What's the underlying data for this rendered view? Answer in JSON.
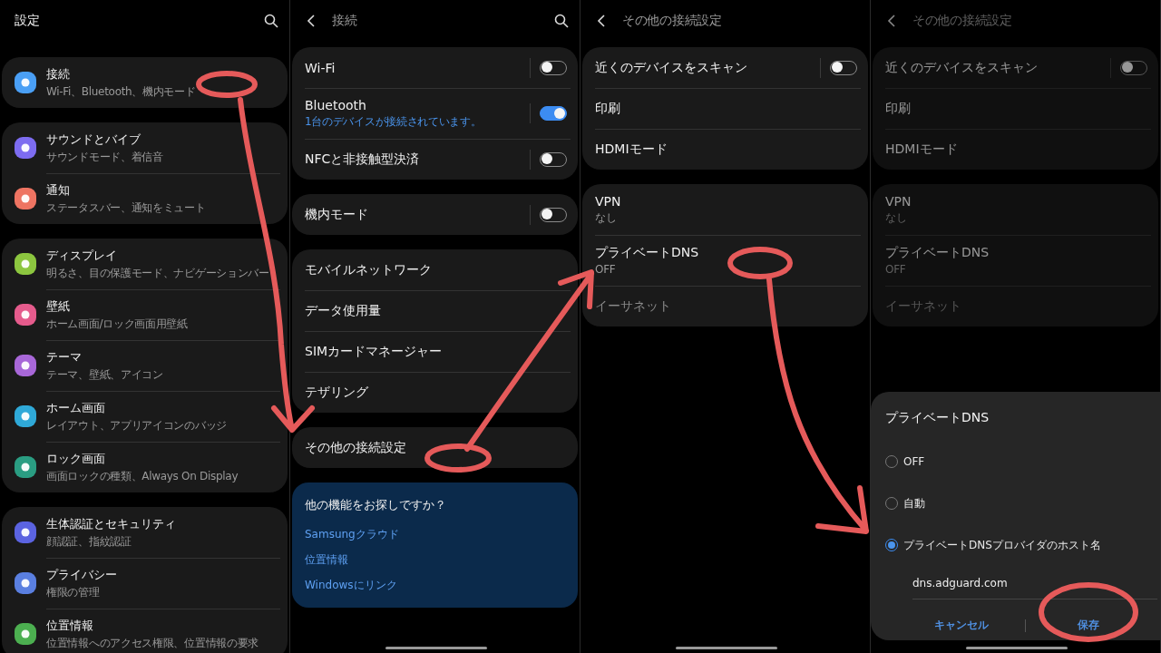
{
  "screens": [
    {
      "kind": "main",
      "title": "設定",
      "search_button": true,
      "dimmed": false,
      "groups": [
        {
          "items": [
            {
              "kind": "link",
              "title": "接続",
              "subtitle": "Wi-Fi、Bluetooth、機内モード",
              "color": "#4a9ff5"
            }
          ]
        },
        {
          "items": [
            {
              "kind": "link",
              "title": "サウンドとバイブ",
              "subtitle": "サウンドモード、着信音",
              "color": "#7d6cf0"
            },
            {
              "kind": "link",
              "title": "通知",
              "subtitle": "ステータスバー、通知をミュート",
              "color": "#ee7462"
            }
          ]
        },
        {
          "items": [
            {
              "kind": "link",
              "title": "ディスプレイ",
              "subtitle": "明るさ、目の保護モード、ナビゲーションバー",
              "color": "#8cc63f"
            },
            {
              "kind": "link",
              "title": "壁紙",
              "subtitle": "ホーム画面/ロック画面用壁紙",
              "color": "#e55b8c"
            },
            {
              "kind": "link",
              "title": "テーマ",
              "subtitle": "テーマ、壁紙、アイコン",
              "color": "#a867d8"
            },
            {
              "kind": "link",
              "title": "ホーム画面",
              "subtitle": "レイアウト、アプリアイコンのバッジ",
              "color": "#2fa9d8"
            },
            {
              "kind": "link",
              "title": "ロック画面",
              "subtitle": "画面ロックの種類、Always On Display",
              "color": "#2a9d82"
            }
          ]
        },
        {
          "items": [
            {
              "kind": "link",
              "title": "生体認証とセキュリティ",
              "subtitle": "顔認証、指紋認証",
              "color": "#5b63e0"
            },
            {
              "kind": "link",
              "title": "プライバシー",
              "subtitle": "権限の管理",
              "color": "#5a7fe0"
            },
            {
              "kind": "link",
              "title": "位置情報",
              "subtitle": "位置情報へのアクセス権限、位置情報の要求",
              "color": "#4caf50"
            }
          ]
        }
      ]
    },
    {
      "kind": "sub",
      "title": "接続",
      "search_button": true,
      "dimmed": false,
      "groups": [
        {
          "items": [
            {
              "kind": "switch",
              "title": "Wi-Fi",
              "on": false
            },
            {
              "kind": "switch",
              "title": "Bluetooth",
              "subtitle": "1台のデバイスが接続されています。",
              "subtitle_accent": true,
              "on": true
            },
            {
              "kind": "switch",
              "title": "NFCと非接触型決済",
              "on": false
            }
          ]
        },
        {
          "items": [
            {
              "kind": "switch",
              "title": "機内モード",
              "on": false
            }
          ]
        },
        {
          "items": [
            {
              "kind": "link",
              "title": "モバイルネットワーク"
            },
            {
              "kind": "link",
              "title": "データ使用量"
            },
            {
              "kind": "link",
              "title": "SIMカードマネージャー"
            },
            {
              "kind": "link",
              "title": "テザリング"
            }
          ]
        },
        {
          "items": [
            {
              "kind": "link",
              "title": "その他の接続設定"
            }
          ]
        }
      ],
      "promo": {
        "title": "他の機能をお探しですか？",
        "links": [
          "Samsungクラウド",
          "位置情報",
          "Windowsにリンク"
        ]
      }
    },
    {
      "kind": "sub",
      "title": "その他の接続設定",
      "search_button": false,
      "dimmed": false,
      "groups": [
        {
          "items": [
            {
              "kind": "switch",
              "title": "近くのデバイスをスキャン",
              "on": false
            },
            {
              "kind": "link",
              "title": "印刷"
            },
            {
              "kind": "link",
              "title": "HDMIモード"
            }
          ]
        },
        {
          "items": [
            {
              "kind": "link",
              "title": "VPN",
              "subtitle": "なし",
              "subtitle_accent": false,
              "disabled": false
            },
            {
              "kind": "link",
              "title": "プライベートDNS",
              "subtitle": "OFF",
              "subtitle_accent": false,
              "disabled": false
            },
            {
              "kind": "link",
              "title": "イーサネット",
              "disabled": true
            }
          ]
        }
      ]
    },
    {
      "kind": "sub",
      "title": "その他の接続設定",
      "search_button": false,
      "dimmed": true,
      "groups": [
        {
          "items": [
            {
              "kind": "switch",
              "title": "近くのデバイスをスキャン",
              "on": false
            },
            {
              "kind": "link",
              "title": "印刷"
            },
            {
              "kind": "link",
              "title": "HDMIモード"
            }
          ]
        },
        {
          "items": [
            {
              "kind": "link",
              "title": "VPN",
              "subtitle": "なし",
              "subtitle_accent": false,
              "disabled": false
            },
            {
              "kind": "link",
              "title": "プライベートDNS",
              "subtitle": "OFF",
              "subtitle_accent": false,
              "disabled": false
            },
            {
              "kind": "link",
              "title": "イーサネット",
              "disabled": true
            }
          ]
        }
      ],
      "dialog": {
        "title": "プライベートDNS",
        "options": [
          {
            "label": "OFF",
            "selected": false
          },
          {
            "label": "自動",
            "selected": false
          },
          {
            "label": "プライベートDNSプロバイダのホスト名",
            "selected": true
          }
        ],
        "hostname": "dns.adguard.com",
        "buttons": [
          "キャンセル",
          "保存"
        ]
      }
    }
  ]
}
